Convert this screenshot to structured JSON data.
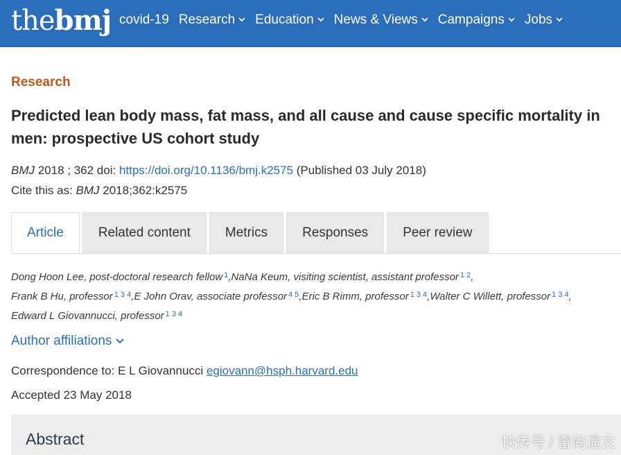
{
  "header": {
    "logo_the": "the",
    "logo_bmj": "bmj",
    "nav": [
      {
        "label": "covid-19",
        "dropdown": false
      },
      {
        "label": "Research",
        "dropdown": true
      },
      {
        "label": "Education",
        "dropdown": true
      },
      {
        "label": "News & Views",
        "dropdown": true
      },
      {
        "label": "Campaigns",
        "dropdown": true
      },
      {
        "label": "Jobs",
        "dropdown": true
      }
    ]
  },
  "article": {
    "section": "Research",
    "title_line1": "Predicted lean body mass, fat mass, and all cause and cause specific mortality in",
    "title_line2": "men: prospective US cohort study",
    "journal": "BMJ",
    "year_vol": " 2018 ; 362  doi: ",
    "doi_link": "https://doi.org/10.1136/bmj.k2575",
    "published": " (Published 03 July 2018)",
    "cite_prefix": "Cite this as: ",
    "cite_journal": "BMJ",
    "cite_ref": " 2018;362:k2575"
  },
  "tabs": [
    "Article",
    "Related content",
    "Metrics",
    "Responses",
    "Peer review"
  ],
  "authors": {
    "a1": "Dong Hoon Lee, post-doctoral research fellow",
    "a1_sup": "1",
    "a2": "NaNa Keum, visiting scientist, assistant professor",
    "a2_sup": "1 2",
    "a3": "Frank B Hu, professor",
    "a3_sup": "1 3 4",
    "a4": "E John Orav, associate professor",
    "a4_sup": "4 5",
    "a5": "Eric B Rimm, professor",
    "a5_sup": "1 3 4",
    "a6": "Walter C Willett, professor",
    "a6_sup": "1 3 4",
    "a7": "Edward L Giovannucci, professor",
    "a7_sup": "1 3 4"
  },
  "affiliations_label": "Author affiliations",
  "correspondence": {
    "prefix": "Correspondence to: E L Giovannucci ",
    "email": "egiovann@hsph.harvard.edu"
  },
  "accepted": "Accepted 23 May 2018",
  "abstract_title": "Abstract",
  "watermark": "快传号 / 雷尚揽文"
}
